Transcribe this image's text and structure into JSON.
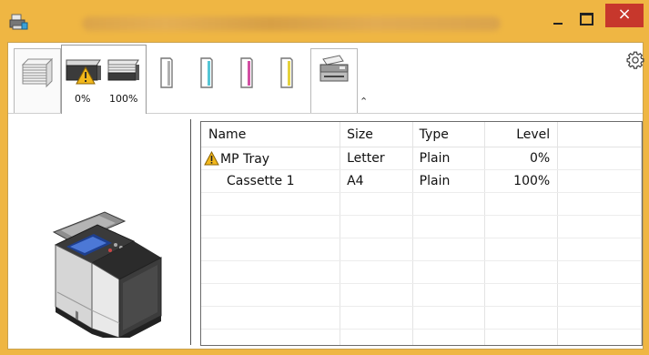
{
  "window": {
    "close_glyph": "×",
    "minimize_glyph": "–"
  },
  "toolbar": {
    "tray_levels": [
      "0%",
      "100%"
    ],
    "expand_glyph": "⌃",
    "toner_colors": [
      "#b0b0b0",
      "#55c6d6",
      "#d24fa3",
      "#e6d23c"
    ],
    "icons": [
      "printer-app-icon",
      "paper-stack-icon",
      "tray-warning-icon",
      "tray-icon",
      "toner-black-icon",
      "toner-cyan-icon",
      "toner-magenta-icon",
      "toner-yellow-icon",
      "scanner-icon",
      "settings-gear-icon"
    ]
  },
  "table": {
    "headers": {
      "name": "Name",
      "size": "Size",
      "type": "Type",
      "level": "Level"
    },
    "rows": [
      {
        "name": "MP Tray",
        "size": "Letter",
        "type": "Plain",
        "level": "0%",
        "warning": true
      },
      {
        "name": "Cassette 1",
        "size": "A4",
        "type": "Plain",
        "level": "100%",
        "warning": false
      }
    ]
  },
  "colors": {
    "frame": "#efb643",
    "close_button": "#c7372c",
    "warning": "#f2b81c"
  }
}
